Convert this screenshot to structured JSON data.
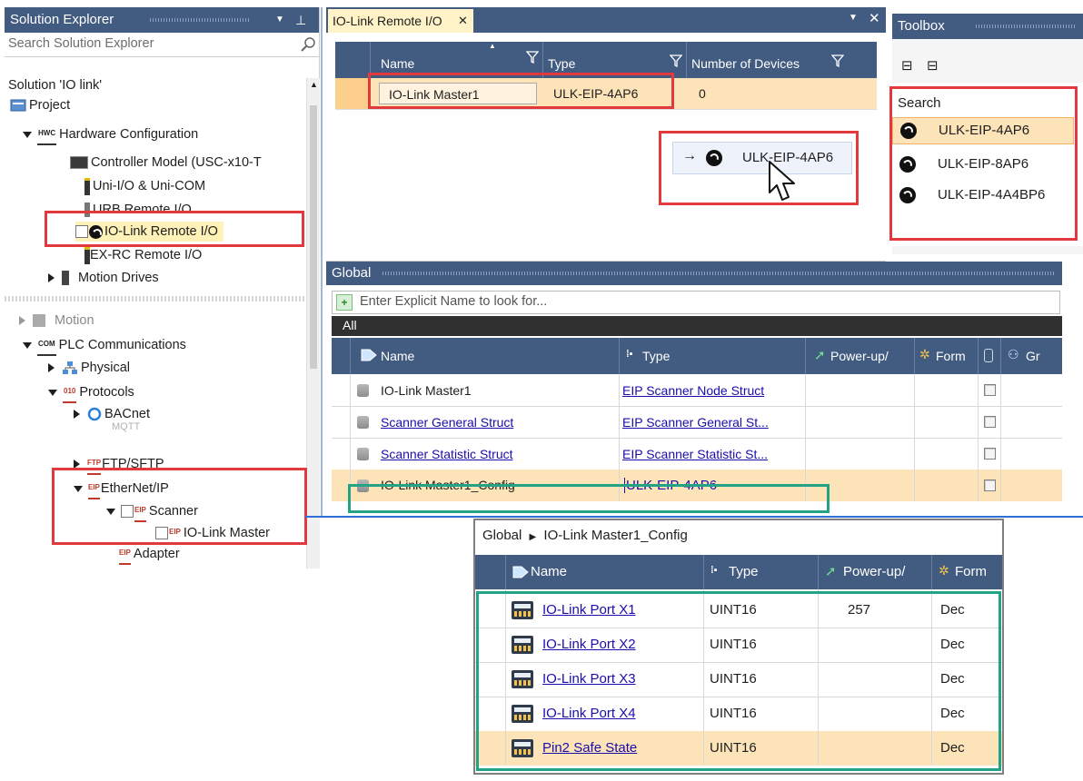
{
  "solution_explorer": {
    "title": "Solution Explorer",
    "search_placeholder": "Search Solution Explorer",
    "items": [
      {
        "label": "Solution 'IO link'"
      },
      {
        "label": "Project"
      },
      {
        "label": "Hardware Configuration",
        "badge": "HWC"
      },
      {
        "label": "Controller Model (USC-x10-T"
      },
      {
        "label": "Uni-I/O & Uni-COM"
      },
      {
        "label": "URB Remote I/O"
      },
      {
        "label": "IO-Link Remote I/O"
      },
      {
        "label": "EX-RC Remote I/O"
      },
      {
        "label": "Motion Drives"
      },
      {
        "label": "Motion"
      },
      {
        "label": "PLC Communications",
        "badge": "COM"
      },
      {
        "label": "Physical"
      },
      {
        "label": "Protocols",
        "badge": "010"
      },
      {
        "label": "BACnet"
      },
      {
        "label": "MQTT"
      },
      {
        "label": "FTP/SFTP",
        "badge": "FTP"
      },
      {
        "label": "EtherNet/IP",
        "badge": "EIP"
      },
      {
        "label": "Scanner",
        "badge": "EIP"
      },
      {
        "label": "IO-Link Master",
        "badge": "EIP"
      },
      {
        "label": "Adapter",
        "badge": "EIP"
      }
    ]
  },
  "io_link_tab": {
    "tab_label": "IO-Link Remote I/O",
    "close_glyph": "✕",
    "columns": [
      "Name",
      "Type",
      "Number of Devices"
    ],
    "rows": [
      {
        "name": "IO-Link Master1",
        "type": "ULK-EIP-4AP6",
        "devices": "0"
      }
    ],
    "drag_item": "ULK-EIP-4AP6"
  },
  "toolbox": {
    "title": "Toolbox",
    "search_label": "Search",
    "items": [
      "ULK-EIP-4AP6",
      "ULK-EIP-8AP6",
      "ULK-EIP-4A4BP6"
    ]
  },
  "global": {
    "title": "Global",
    "search_placeholder": "Enter Explicit Name to look for...",
    "tab_all": "All",
    "columns": [
      "Name",
      "Type",
      "Power-up/",
      "Form",
      "",
      "Gr"
    ],
    "rows": [
      {
        "name": "IO-Link Master1",
        "type": "EIP Scanner Node Struct"
      },
      {
        "name": "Scanner General Struct",
        "type": "EIP Scanner General St..."
      },
      {
        "name": "Scanner Statistic Struct",
        "type": "EIP Scanner Statistic St..."
      },
      {
        "name": "IO-Link Master1_Config",
        "type": "ULK-EIP-4AP6"
      }
    ]
  },
  "config_popup": {
    "breadcrumb_root": "Global",
    "breadcrumb_sep": "▶",
    "breadcrumb_leaf": "IO-Link Master1_Config",
    "columns": [
      "Name",
      "Type",
      "Power-up/",
      "Form"
    ],
    "rows": [
      {
        "name": "IO-Link Port X1",
        "type": "UINT16",
        "power": "257",
        "format": "Dec"
      },
      {
        "name": "IO-Link Port X2",
        "type": "UINT16",
        "power": "",
        "format": "Dec"
      },
      {
        "name": "IO-Link Port X3",
        "type": "UINT16",
        "power": "",
        "format": "Dec"
      },
      {
        "name": "IO-Link Port X4",
        "type": "UINT16",
        "power": "",
        "format": "Dec"
      },
      {
        "name": "Pin2 Safe State",
        "type": "UINT16",
        "power": "",
        "format": "Dec"
      }
    ]
  },
  "colors": {
    "header": "#425b80",
    "highlight_red": "#e2393d",
    "highlight_green": "#22a386",
    "selected_row": "#fde3b8",
    "link": "#1a0dab"
  }
}
